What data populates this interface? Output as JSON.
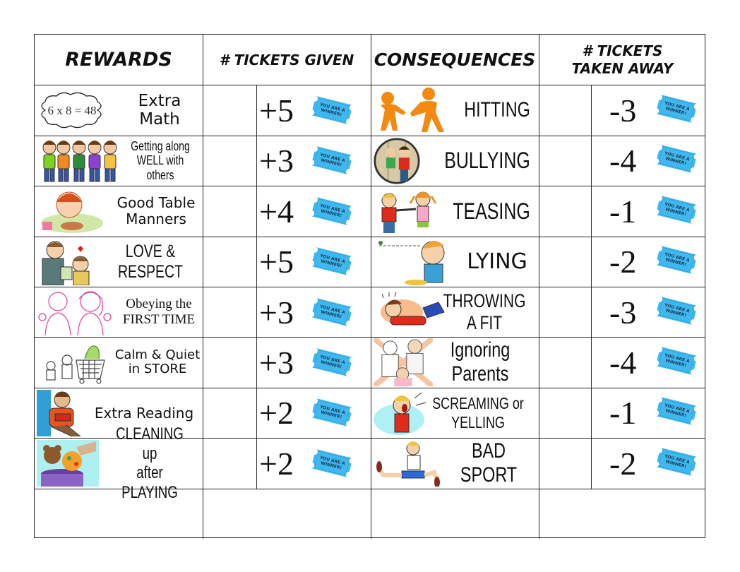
{
  "chart_title": "",
  "headers": {
    "rewards": "REWARDS",
    "tickets_given": "# TICKETS GIVEN",
    "consequences": "CONSEQUENCES",
    "tickets_taken_line1": "# TICKETS",
    "tickets_taken_line2": "TAKEN AWAY"
  },
  "ticket_icon": {
    "name": "ticket-icon",
    "text_line1": "YOU ARE A",
    "text_line2": "WINNER!",
    "color": "#3fb8ef"
  },
  "rewards": [
    {
      "label": "Extra Math",
      "image": "math-cloud-icon",
      "image_text": "6 x 8 = 48",
      "value": "+5"
    },
    {
      "label_line1": "Getting along",
      "label_line2": "WELL with others",
      "image": "kids-group-icon",
      "value": "+3"
    },
    {
      "label_line1": "Good Table",
      "label_line2": "Manners",
      "image": "boy-eating-icon",
      "value": "+4"
    },
    {
      "label": "LOVE & RESPECT",
      "image": "parent-child-heart-icon",
      "value": "+5"
    },
    {
      "label_line1": "Obeying the",
      "label_line2": "FIRST TIME",
      "image": "parents-sketch-icon",
      "value": "+3"
    },
    {
      "label_line1": "Calm & Quiet",
      "label_line2": "in STORE",
      "image": "shopping-cart-icon",
      "value": "+3"
    },
    {
      "label": "Extra Reading",
      "image": "child-reading-icon",
      "value": "+2"
    },
    {
      "label_line1": "CLEANING up",
      "label_line2": "after PLAYING",
      "image": "toys-bin-icon",
      "value": "+2"
    }
  ],
  "consequences": [
    {
      "label": "HITTING",
      "image": "figures-hitting-icon",
      "value": "-3"
    },
    {
      "label": "BULLYING",
      "image": "bully-locker-icon",
      "value": "-4"
    },
    {
      "label": "TEASING",
      "image": "kids-teasing-icon",
      "value": "-1"
    },
    {
      "label": "LYING",
      "image": "long-nose-icon",
      "value": "-2"
    },
    {
      "label": "THROWING A FIT",
      "image": "tantrum-icon",
      "value": "-3"
    },
    {
      "label": "Ignoring Parents",
      "image": "ignoring-parents-icon",
      "value": "-4"
    },
    {
      "label": "SCREAMING or YELLING",
      "image": "screaming-child-icon",
      "value": "-1"
    },
    {
      "label": "BAD SPORT",
      "image": "bad-sport-icon",
      "value": "-2"
    }
  ],
  "empty_row": [
    "",
    "",
    "",
    ""
  ]
}
